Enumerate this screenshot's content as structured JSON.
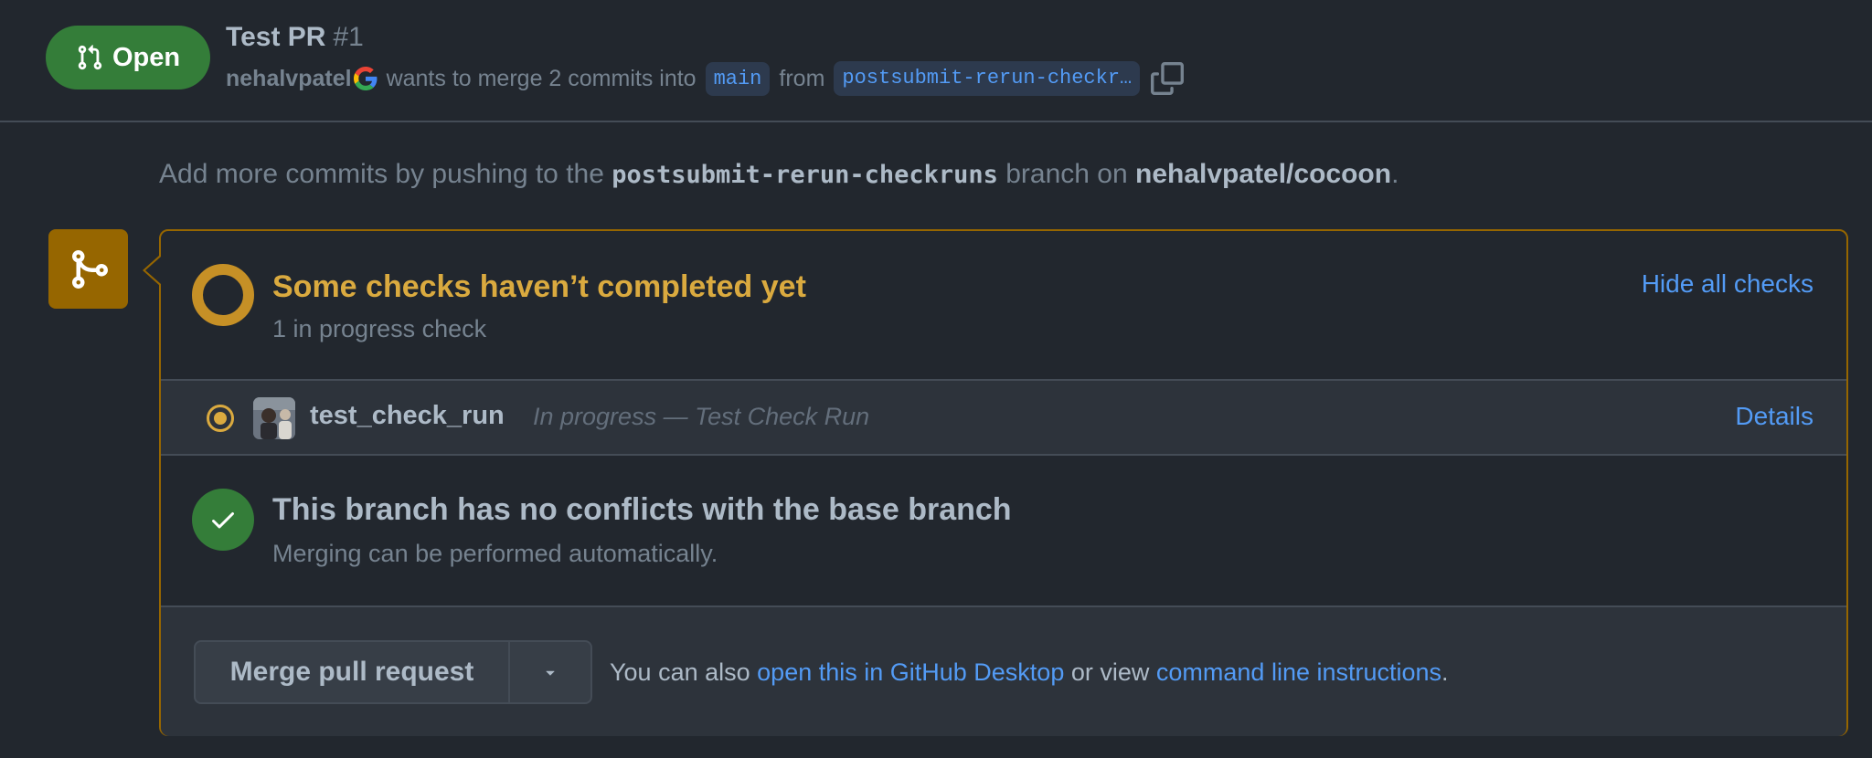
{
  "header": {
    "state": "Open",
    "title": "Test PR",
    "number": "#1",
    "author": "nehalvpatel",
    "meta_text": "wants to merge 2 commits into",
    "base_branch": "main",
    "from_text": "from",
    "head_branch": "postsubmit-rerun-checkr…"
  },
  "hint": {
    "prefix": "Add more commits by pushing to the",
    "branch": "postsubmit-rerun-checkruns",
    "middle": "branch on",
    "repo": "nehalvpatel/cocoon",
    "suffix": "."
  },
  "checks": {
    "title": "Some checks haven’t completed yet",
    "subtitle": "1 in progress check",
    "toggle_label": "Hide all checks",
    "runs": [
      {
        "name": "test_check_run",
        "status": "In progress — Test Check Run",
        "details_label": "Details"
      }
    ]
  },
  "conflicts": {
    "title": "This branch has no conflicts with the base branch",
    "subtitle": "Merging can be performed automatically."
  },
  "merge": {
    "button_label": "Merge pull request",
    "note_prefix": "You can also",
    "desktop_link": "open this in GitHub Desktop",
    "note_middle": "or view",
    "cli_link": "command line instructions",
    "note_suffix": "."
  },
  "colors": {
    "background": "#22272e",
    "open_green": "#347d39",
    "pending_amber": "#c69026",
    "link_blue": "#539bf5"
  },
  "icons": {
    "state": "git-pull-request-icon",
    "author_badge": "google-g-icon",
    "copy": "copy-icon",
    "merge_tile": "git-merge-icon",
    "pending": "pending-ring-icon",
    "run_status": "in-progress-dot-icon",
    "ok": "check-circle-icon",
    "caret": "triangle-down-icon"
  }
}
